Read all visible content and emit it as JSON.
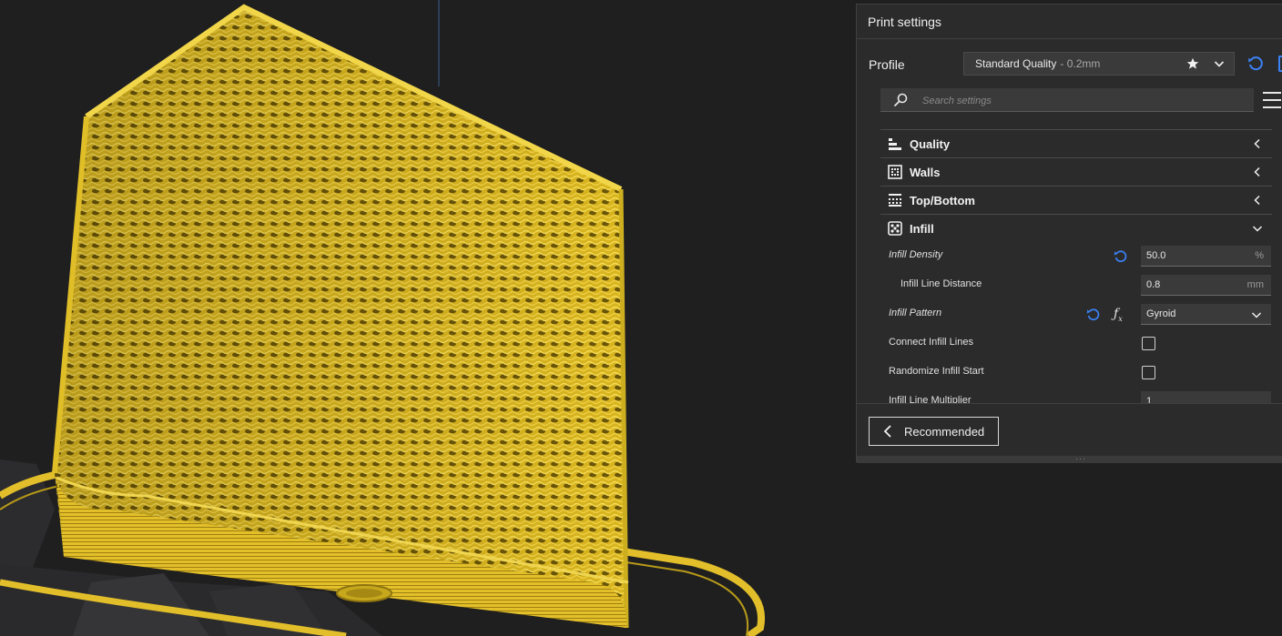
{
  "panel": {
    "title": "Print settings",
    "profile": {
      "label": "Profile",
      "name": "Standard Quality",
      "detail": "- 0.2mm"
    },
    "search": {
      "placeholder": "Search settings"
    },
    "categories": [
      {
        "label": "Quality",
        "icon": "quality-icon",
        "expanded": false
      },
      {
        "label": "Walls",
        "icon": "walls-icon",
        "expanded": false
      },
      {
        "label": "Top/Bottom",
        "icon": "top-bottom-icon",
        "expanded": false
      },
      {
        "label": "Infill",
        "icon": "infill-icon",
        "expanded": true
      }
    ],
    "infill_settings": {
      "density": {
        "label": "Infill Density",
        "value": "50.0",
        "unit": "%"
      },
      "line_distance": {
        "label": "Infill Line Distance",
        "value": "0.8",
        "unit": "mm"
      },
      "pattern": {
        "label": "Infill Pattern",
        "value": "Gyroid"
      },
      "connect_lines": {
        "label": "Connect Infill Lines",
        "checked": false
      },
      "randomize_start": {
        "label": "Randomize Infill Start",
        "checked": false
      },
      "line_multiplier": {
        "label": "Infill Line Multiplier",
        "value": "1"
      }
    },
    "footer": {
      "recommended_label": "Recommended"
    }
  },
  "colors": {
    "background": "#1f1f20",
    "panel": "#2b2b2c",
    "model_yellow": "#e6c22c",
    "accent_blue": "#3b82f6"
  }
}
